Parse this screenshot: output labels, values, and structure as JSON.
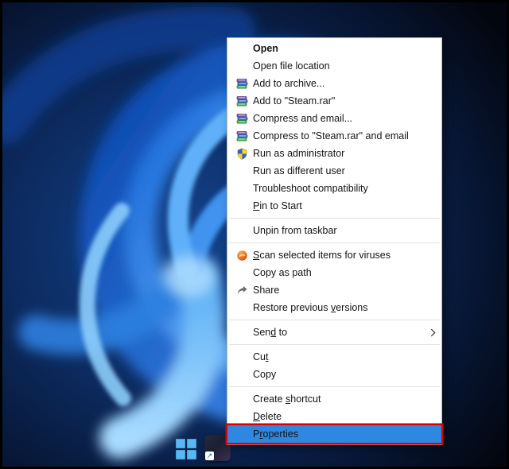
{
  "desktop": {
    "wallpaper_name": "windows-11-bloom",
    "accent_blue": "#3e8ef0",
    "background_dark": "#071634"
  },
  "taskbar": {
    "icons": [
      {
        "name": "windows-start"
      },
      {
        "name": "app-shortcut"
      }
    ]
  },
  "annotation": {
    "color": "#dc0000",
    "target": "Properties"
  },
  "context_menu": {
    "selected_item": "Properties",
    "items": [
      {
        "label": "Open",
        "bold": true
      },
      {
        "label": "Open file location"
      },
      {
        "label": "Add to archive...",
        "icon": "winrar"
      },
      {
        "label": "Add to \"Steam.rar\"",
        "icon": "winrar"
      },
      {
        "label": "Compress and email...",
        "icon": "winrar"
      },
      {
        "label": "Compress to \"Steam.rar\" and email",
        "icon": "winrar"
      },
      {
        "label": "Run as administrator",
        "icon": "uac-shield"
      },
      {
        "label": "Run as different user"
      },
      {
        "label": "Troubleshoot compatibility"
      },
      {
        "label": "Pin to Start",
        "u": 0
      },
      {
        "type": "separator"
      },
      {
        "label": "Unpin from taskbar"
      },
      {
        "type": "separator"
      },
      {
        "label": "Scan selected items for viruses",
        "icon": "antivirus",
        "u": 0
      },
      {
        "label": "Copy as path"
      },
      {
        "label": "Share",
        "icon": "share"
      },
      {
        "label": "Restore previous versions",
        "u": 17
      },
      {
        "type": "separator"
      },
      {
        "label": "Send to",
        "u": 3,
        "submenu": true
      },
      {
        "type": "separator"
      },
      {
        "label": "Cut",
        "u": 2
      },
      {
        "label": "Copy"
      },
      {
        "type": "separator"
      },
      {
        "label": "Create shortcut",
        "u": 7
      },
      {
        "label": "Delete",
        "u": 0
      },
      {
        "label": "Properties",
        "u": 1,
        "selected": true,
        "annotated": true
      }
    ]
  }
}
